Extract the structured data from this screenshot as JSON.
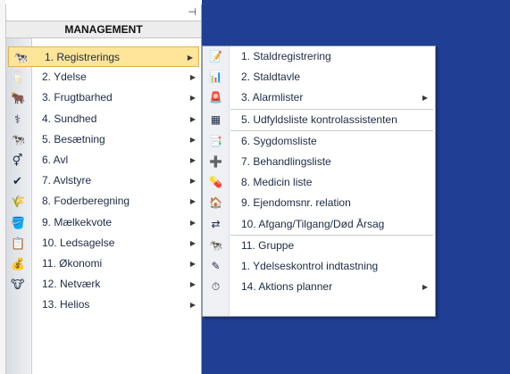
{
  "window": {
    "pin_glyph": "⊣"
  },
  "panel": {
    "title": "MANAGEMENT"
  },
  "main_menu": [
    {
      "label": "1. Registrerings",
      "icon": "cow-registration-icon",
      "glyph": "🐄",
      "has_submenu": true,
      "active": true
    },
    {
      "label": "2. Ydelse",
      "icon": "milk-yield-icon",
      "glyph": "🥛",
      "has_submenu": true
    },
    {
      "label": "3. Frugtbarhed",
      "icon": "fertility-icon",
      "glyph": "🐂",
      "has_submenu": true
    },
    {
      "label": "4. Sundhed",
      "icon": "health-icon",
      "glyph": "⚕",
      "has_submenu": true
    },
    {
      "label": "5. Besætning",
      "icon": "herd-icon",
      "glyph": "🐄",
      "has_submenu": true
    },
    {
      "label": "6. Avl",
      "icon": "breeding-icon",
      "glyph": "⚥",
      "has_submenu": true
    },
    {
      "label": "7. Avlstyre",
      "icon": "breeding-control-icon",
      "glyph": "✔",
      "has_submenu": true
    },
    {
      "label": "8. Foderberegning",
      "icon": "feed-calculation-icon",
      "glyph": "🌾",
      "has_submenu": true
    },
    {
      "label": "9. Mælkekvote",
      "icon": "milk-quota-icon",
      "glyph": "🪣",
      "has_submenu": true
    },
    {
      "label": "10. Ledsagelse",
      "icon": "accompaniment-icon",
      "glyph": "📋",
      "has_submenu": true
    },
    {
      "label": "11. Økonomi",
      "icon": "economy-icon",
      "glyph": "💰",
      "has_submenu": true
    },
    {
      "label": "12. Netværk",
      "icon": "network-icon",
      "glyph": "🐮",
      "has_submenu": true
    },
    {
      "label": "13. Helios",
      "icon": "helios-icon",
      "glyph": "",
      "has_submenu": true
    }
  ],
  "submenu": {
    "items": [
      {
        "label": "1. Staldregistrering",
        "icon": "barn-registration-icon",
        "glyph": "📝"
      },
      {
        "label": "2. Staldtavle",
        "icon": "barn-board-icon",
        "glyph": "📊"
      },
      {
        "label": "3. Alarmlister",
        "icon": "alarm-list-icon",
        "glyph": "🚨",
        "has_submenu": true
      },
      {
        "separator": true
      },
      {
        "label": "5. Udfyldsliste kontrolassistenten",
        "icon": "fill-list-icon",
        "glyph": "▦"
      },
      {
        "separator": true
      },
      {
        "label": "6. Sygdomsliste",
        "icon": "disease-list-icon",
        "glyph": "📑"
      },
      {
        "label": "7. Behandlingsliste",
        "icon": "treatment-list-icon",
        "glyph": "➕"
      },
      {
        "label": "8. Medicin liste",
        "icon": "medicine-list-icon",
        "glyph": "💊"
      },
      {
        "label": "9. Ejendomsnr. relation",
        "icon": "property-relation-icon",
        "glyph": "🏠"
      },
      {
        "label": "10. Afgang/Tilgang/Død Årsag",
        "icon": "departure-arrival-icon",
        "glyph": "⇄"
      },
      {
        "separator": true
      },
      {
        "label": "11. Gruppe",
        "icon": "group-icon",
        "glyph": "🐄"
      },
      {
        "label": "1. Ydelseskontrol indtastning",
        "icon": "yield-control-input-icon",
        "glyph": "✎"
      },
      {
        "label": "14. Aktions planner",
        "icon": "action-planner-icon",
        "glyph": "⏱",
        "has_submenu": true
      }
    ]
  }
}
